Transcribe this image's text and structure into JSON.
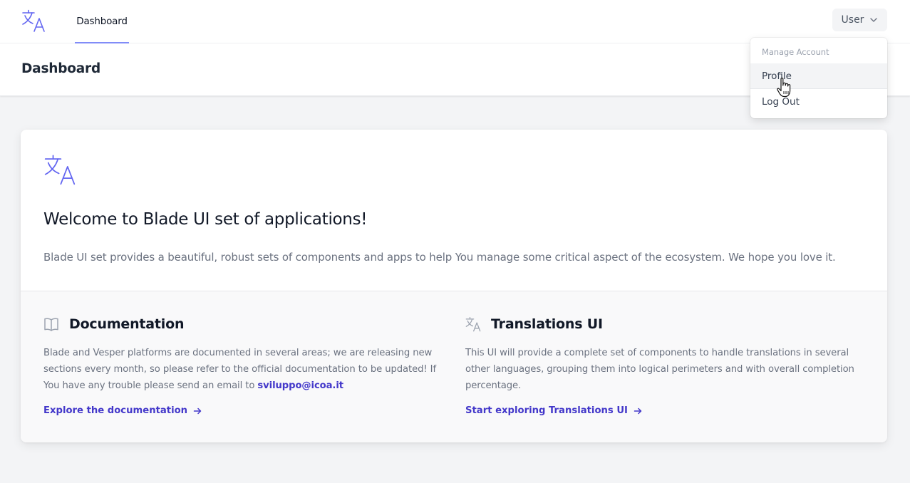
{
  "nav": {
    "logo_icon": "translate-icon",
    "dashboard_link": "Dashboard",
    "user_menu_label": "User",
    "user_menu_icon": "chevron-down-icon"
  },
  "header": {
    "title": "Dashboard"
  },
  "dropdown": {
    "section_label": "Manage Account",
    "items": [
      "Profile",
      "Log Out"
    ]
  },
  "welcome": {
    "title": "Welcome to Blade UI set of applications!",
    "description": "Blade UI set provides a beautiful, robust sets of components and apps to help You manage some critical aspect of the ecosystem. We hope you love it."
  },
  "documentation": {
    "icon": "book-icon",
    "title": "Documentation",
    "text": "Blade and Vesper platforms are documented in several areas; we are releasing new sections every month, so please refer to the official documentation to be updated! If You have any trouble please send an email to",
    "email": "sviluppo@icoa.it",
    "link": "Explore the documentation"
  },
  "translations": {
    "icon": "translate-icon",
    "title": "Translations UI",
    "text": "This UI will provide a complete set of components to handle translations in several other languages, grouping them into logical perimeters and with overall completion percentage.",
    "link": "Start exploring Translations UI"
  },
  "colors": {
    "accent": "#4338ca",
    "nav_indicator": "#818cf8",
    "logo": "#6366f1"
  }
}
